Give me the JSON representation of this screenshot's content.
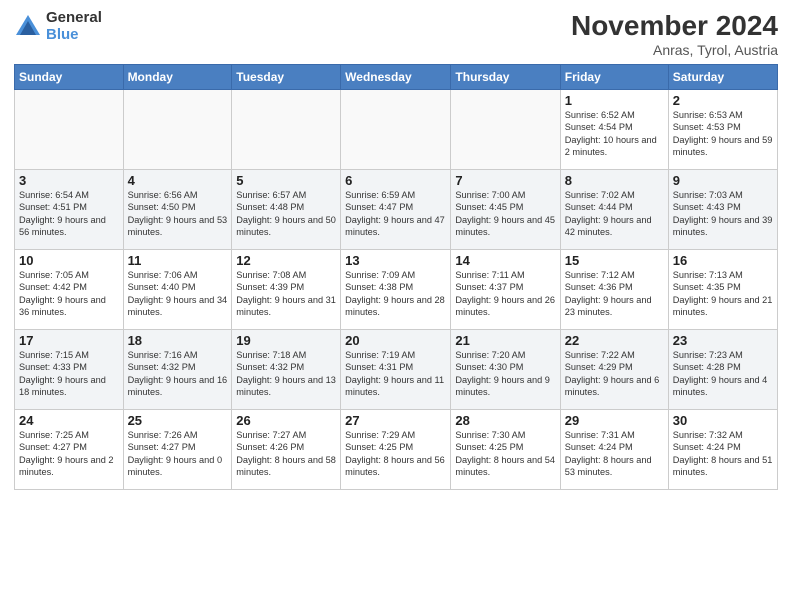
{
  "logo": {
    "general": "General",
    "blue": "Blue"
  },
  "title": "November 2024",
  "location": "Anras, Tyrol, Austria",
  "days_header": [
    "Sunday",
    "Monday",
    "Tuesday",
    "Wednesday",
    "Thursday",
    "Friday",
    "Saturday"
  ],
  "weeks": [
    {
      "shaded": false,
      "days": [
        {
          "num": "",
          "info": ""
        },
        {
          "num": "",
          "info": ""
        },
        {
          "num": "",
          "info": ""
        },
        {
          "num": "",
          "info": ""
        },
        {
          "num": "",
          "info": ""
        },
        {
          "num": "1",
          "info": "Sunrise: 6:52 AM\nSunset: 4:54 PM\nDaylight: 10 hours\nand 2 minutes."
        },
        {
          "num": "2",
          "info": "Sunrise: 6:53 AM\nSunset: 4:53 PM\nDaylight: 9 hours\nand 59 minutes."
        }
      ]
    },
    {
      "shaded": true,
      "days": [
        {
          "num": "3",
          "info": "Sunrise: 6:54 AM\nSunset: 4:51 PM\nDaylight: 9 hours\nand 56 minutes."
        },
        {
          "num": "4",
          "info": "Sunrise: 6:56 AM\nSunset: 4:50 PM\nDaylight: 9 hours\nand 53 minutes."
        },
        {
          "num": "5",
          "info": "Sunrise: 6:57 AM\nSunset: 4:48 PM\nDaylight: 9 hours\nand 50 minutes."
        },
        {
          "num": "6",
          "info": "Sunrise: 6:59 AM\nSunset: 4:47 PM\nDaylight: 9 hours\nand 47 minutes."
        },
        {
          "num": "7",
          "info": "Sunrise: 7:00 AM\nSunset: 4:45 PM\nDaylight: 9 hours\nand 45 minutes."
        },
        {
          "num": "8",
          "info": "Sunrise: 7:02 AM\nSunset: 4:44 PM\nDaylight: 9 hours\nand 42 minutes."
        },
        {
          "num": "9",
          "info": "Sunrise: 7:03 AM\nSunset: 4:43 PM\nDaylight: 9 hours\nand 39 minutes."
        }
      ]
    },
    {
      "shaded": false,
      "days": [
        {
          "num": "10",
          "info": "Sunrise: 7:05 AM\nSunset: 4:42 PM\nDaylight: 9 hours\nand 36 minutes."
        },
        {
          "num": "11",
          "info": "Sunrise: 7:06 AM\nSunset: 4:40 PM\nDaylight: 9 hours\nand 34 minutes."
        },
        {
          "num": "12",
          "info": "Sunrise: 7:08 AM\nSunset: 4:39 PM\nDaylight: 9 hours\nand 31 minutes."
        },
        {
          "num": "13",
          "info": "Sunrise: 7:09 AM\nSunset: 4:38 PM\nDaylight: 9 hours\nand 28 minutes."
        },
        {
          "num": "14",
          "info": "Sunrise: 7:11 AM\nSunset: 4:37 PM\nDaylight: 9 hours\nand 26 minutes."
        },
        {
          "num": "15",
          "info": "Sunrise: 7:12 AM\nSunset: 4:36 PM\nDaylight: 9 hours\nand 23 minutes."
        },
        {
          "num": "16",
          "info": "Sunrise: 7:13 AM\nSunset: 4:35 PM\nDaylight: 9 hours\nand 21 minutes."
        }
      ]
    },
    {
      "shaded": true,
      "days": [
        {
          "num": "17",
          "info": "Sunrise: 7:15 AM\nSunset: 4:33 PM\nDaylight: 9 hours\nand 18 minutes."
        },
        {
          "num": "18",
          "info": "Sunrise: 7:16 AM\nSunset: 4:32 PM\nDaylight: 9 hours\nand 16 minutes."
        },
        {
          "num": "19",
          "info": "Sunrise: 7:18 AM\nSunset: 4:32 PM\nDaylight: 9 hours\nand 13 minutes."
        },
        {
          "num": "20",
          "info": "Sunrise: 7:19 AM\nSunset: 4:31 PM\nDaylight: 9 hours\nand 11 minutes."
        },
        {
          "num": "21",
          "info": "Sunrise: 7:20 AM\nSunset: 4:30 PM\nDaylight: 9 hours\nand 9 minutes."
        },
        {
          "num": "22",
          "info": "Sunrise: 7:22 AM\nSunset: 4:29 PM\nDaylight: 9 hours\nand 6 minutes."
        },
        {
          "num": "23",
          "info": "Sunrise: 7:23 AM\nSunset: 4:28 PM\nDaylight: 9 hours\nand 4 minutes."
        }
      ]
    },
    {
      "shaded": false,
      "days": [
        {
          "num": "24",
          "info": "Sunrise: 7:25 AM\nSunset: 4:27 PM\nDaylight: 9 hours\nand 2 minutes."
        },
        {
          "num": "25",
          "info": "Sunrise: 7:26 AM\nSunset: 4:27 PM\nDaylight: 9 hours\nand 0 minutes."
        },
        {
          "num": "26",
          "info": "Sunrise: 7:27 AM\nSunset: 4:26 PM\nDaylight: 8 hours\nand 58 minutes."
        },
        {
          "num": "27",
          "info": "Sunrise: 7:29 AM\nSunset: 4:25 PM\nDaylight: 8 hours\nand 56 minutes."
        },
        {
          "num": "28",
          "info": "Sunrise: 7:30 AM\nSunset: 4:25 PM\nDaylight: 8 hours\nand 54 minutes."
        },
        {
          "num": "29",
          "info": "Sunrise: 7:31 AM\nSunset: 4:24 PM\nDaylight: 8 hours\nand 53 minutes."
        },
        {
          "num": "30",
          "info": "Sunrise: 7:32 AM\nSunset: 4:24 PM\nDaylight: 8 hours\nand 51 minutes."
        }
      ]
    }
  ]
}
